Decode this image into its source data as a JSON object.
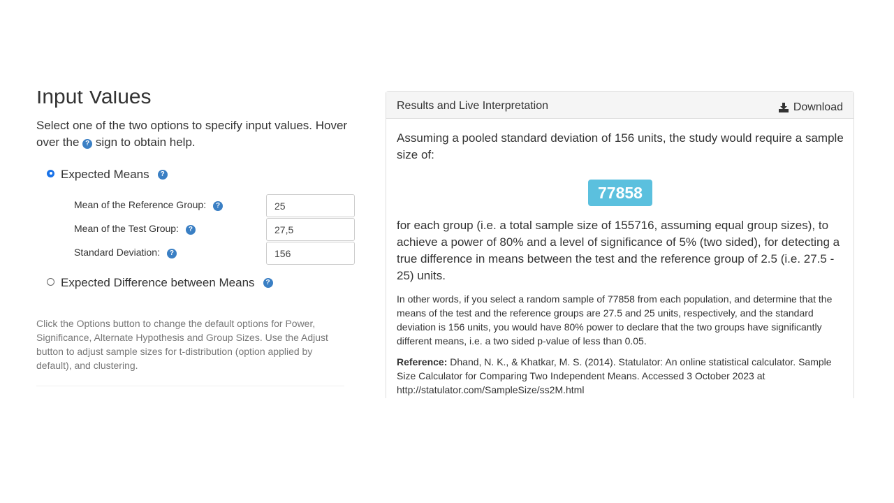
{
  "left": {
    "heading": "Input Values",
    "intro_part1": "Select one of the two options to specify input values. Hover over the",
    "help_glyph": "?",
    "intro_part2": "sign to obtain help.",
    "options": [
      {
        "label": "Expected Means",
        "selected": true
      },
      {
        "label": "Expected Difference between Means",
        "selected": false
      }
    ],
    "fields": [
      {
        "label": "Mean of the Reference Group:",
        "value": "25"
      },
      {
        "label": "Mean of the Test Group:",
        "value": "27,5"
      },
      {
        "label": "Standard Deviation:",
        "value": "156"
      }
    ],
    "help_text": "Click the Options button to change the default options for Power, Significance, Alternate Hypothesis and Group Sizes. Use the Adjust button to adjust sample sizes for t-distribution (option applied by default), and clustering."
  },
  "results": {
    "title": "Results and Live Interpretation",
    "download_label": "Download",
    "lead": "Assuming a pooled standard deviation of 156 units, the study would require a sample size of:",
    "sample_size": "77858",
    "lead2": "for each group (i.e. a total sample size of 155716, assuming equal group sizes), to achieve a power of 80% and a level of significance of 5% (two sided), for detecting a true difference in means between the test and the reference group of 2.5 (i.e. 27.5 - 25) units.",
    "other_words": "In other words, if you select a random sample of 77858 from each population, and determine that the means of the test and the reference groups are 27.5 and 25 units, respectively, and the standard deviation is 156 units, you would have 80% power to declare that the two groups have significantly different means, i.e. a two sided p-value of less than 0.05.",
    "reference_label": "Reference:",
    "reference_text": "Dhand, N. K., & Khatkar, M. S. (2014). Statulator: An online statistical calculator. Sample Size Calculator for Comparing Two Independent Means. Accessed 3 October 2023 at http://statulator.com/SampleSize/ss2M.html"
  },
  "colors": {
    "help_icon": "#3a7fc4",
    "badge": "#5bc0de",
    "radio_selected": "#1a73e8"
  },
  "icons": {
    "help": "question-circle-icon",
    "download": "download-icon"
  }
}
